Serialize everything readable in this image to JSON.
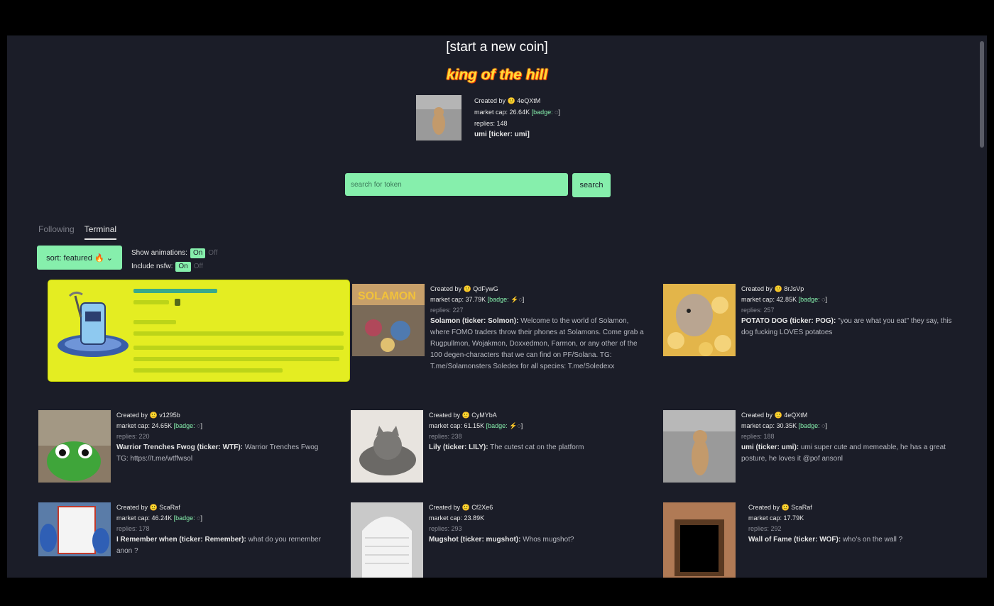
{
  "header": {
    "start_link": "[start a new coin]",
    "king_title": "king of the hill"
  },
  "koth": {
    "created_by_label": "Created by",
    "creator": "4eQXtM",
    "market_cap_label": "market cap:",
    "market_cap": "26.64K",
    "badge": "[badge:",
    "replies_label": "replies:",
    "replies": "148",
    "name": "umi [ticker: umi]"
  },
  "search": {
    "placeholder": "search for token",
    "button": "search"
  },
  "tabs": [
    "Following",
    "Terminal"
  ],
  "controls": {
    "sort": "sort: featured 🔥 ⌄",
    "animations_label": "Show animations:",
    "nsfw_label": "Include nsfw:",
    "on": "On",
    "off": "Off"
  },
  "coins": [
    {
      "creator": "QdFywG",
      "market_cap": "37.79K",
      "badge": "[badge:",
      "replies": "227",
      "title": "Solamon (ticker: Solmon):",
      "desc": "Welcome to the world of Solamon, where FOMO traders throw their phones at Solamons. Come grab a Rugpullmon, Wojakmon, Doxxedmon, Farmon, or any other of the 100 degen-characters that we can find on PF/Solana. TG: T.me/Solamonsters Soledex for all species: T.me/Soledexx"
    },
    {
      "creator": "8rJsVp",
      "market_cap": "42.85K",
      "badge": "[badge:",
      "replies": "257",
      "title": "POTATO DOG (ticker: POG):",
      "desc": "\"you are what you eat\" they say, this dog fucking LOVES potatoes"
    },
    {
      "creator": "v1295b",
      "market_cap": "24.65K",
      "badge": "[badge:",
      "replies": "220",
      "title": "Warrior Trenches Fwog (ticker: WTF):",
      "desc": "Warrior Trenches Fwog TG: https://t.me/wtffwsol"
    },
    {
      "creator": "CyMYbA",
      "market_cap": "61.15K",
      "badge": "[badge:",
      "replies": "238",
      "title": "Lily (ticker: LILY):",
      "desc": "The cutest cat on the platform"
    },
    {
      "creator": "4eQXtM",
      "market_cap": "30.35K",
      "badge": "[badge:",
      "replies": "188",
      "title": "umi (ticker: umi):",
      "desc": "umi super cute and memeable, he has a great posture, he loves it @pof ansonl"
    },
    {
      "creator": "ScaRaf",
      "market_cap": "46.24K",
      "badge": "[badge:",
      "replies": "178",
      "title": "I Remember when (ticker: Remember):",
      "desc": "what do you remember anon ?"
    },
    {
      "creator": "Cf2Xe6",
      "market_cap": "23.89K",
      "badge": "",
      "replies": "293",
      "title": "Mugshot (ticker: mugshot):",
      "desc": "Whos mugshot?"
    },
    {
      "creator": "ScaRaf",
      "market_cap": "17.79K",
      "badge": "",
      "replies": "292",
      "title": "Wall of Fame (ticker: WOF):",
      "desc": "who's on the wall ?"
    }
  ],
  "labels": {
    "created_by": "Created by",
    "market_cap": "market cap:",
    "replies": "replies:"
  },
  "colors": {
    "accent_green": "#86efac",
    "page_bg": "#1b1d28",
    "featured_yellow": "#e4ed22",
    "king_orange": "#ffdb3a"
  }
}
